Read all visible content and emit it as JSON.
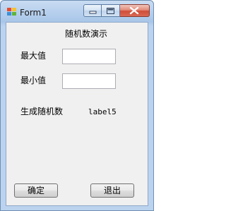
{
  "window": {
    "title": "Form1",
    "icon": "app-form-icon",
    "caption_buttons": [
      "minimize-icon",
      "maximize-icon",
      "close-icon"
    ]
  },
  "form": {
    "heading": "随机数演示",
    "max_label": "最大值",
    "max_value": "",
    "min_label": "最小值",
    "min_value": "",
    "result_label": "生成随机数",
    "result_value": "label5",
    "ok_button": "确定",
    "exit_button": "退出"
  }
}
